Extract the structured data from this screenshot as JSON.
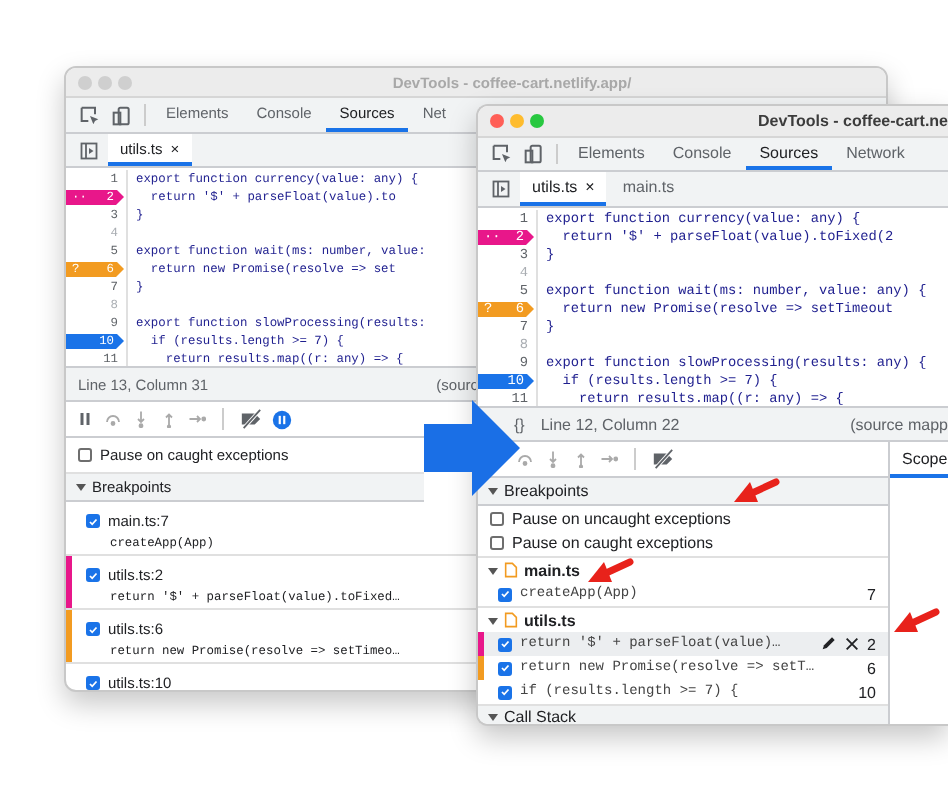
{
  "left_window": {
    "title": "DevTools - coffee-cart.netlify.app/",
    "active": false,
    "tabs": [
      {
        "label": "Elements",
        "selected": false
      },
      {
        "label": "Console",
        "selected": false
      },
      {
        "label": "Sources",
        "selected": true
      },
      {
        "label": "Net",
        "selected": false
      }
    ],
    "file_tabs": [
      {
        "label": "utils.ts",
        "close": "×",
        "selected": true
      }
    ],
    "code_lines": [
      {
        "number": "1",
        "kind": "plain",
        "text": "export function currency(value: any) {"
      },
      {
        "number": "2",
        "kind": "logpoint",
        "badge": "··",
        "text": "  return '$' + parseFloat(value).to"
      },
      {
        "number": "3",
        "kind": "plain",
        "text": "}"
      },
      {
        "number": "4",
        "kind": "plain",
        "faded": true
      },
      {
        "number": "5",
        "kind": "plain",
        "text": "export function wait(ms: number, value:"
      },
      {
        "number": "6",
        "kind": "conditional",
        "badge": "?",
        "text": "  return new Promise(resolve => set"
      },
      {
        "number": "7",
        "kind": "plain",
        "text": "}"
      },
      {
        "number": "8",
        "kind": "plain",
        "faded": true
      },
      {
        "number": "9",
        "kind": "plain",
        "text": "export function slowProcessing(results:"
      },
      {
        "number": "10",
        "kind": "regular",
        "text": "  if (results.length >= 7) {"
      },
      {
        "number": "11",
        "kind": "plain",
        "text": "    return results.map((r: any) => {"
      }
    ],
    "status": {
      "position": "Line 13, Column 31",
      "source": "(sourc"
    },
    "pause_options": [
      {
        "label": "Pause on caught exceptions",
        "checked": false
      }
    ],
    "breakpoints_header": {
      "label": "Breakpoints",
      "expanded": true
    },
    "breakpoints": [
      {
        "location": "main.ts:7",
        "code": "createApp(App)",
        "checked": true
      },
      {
        "location": "utils.ts:2",
        "code": "return '$' + parseFloat(value).toFixed…",
        "checked": true,
        "color": "#e8178a"
      },
      {
        "location": "utils.ts:6",
        "code": "return new Promise(resolve => setTimeo…",
        "checked": true,
        "color": "#f29b21"
      },
      {
        "location": "utils.ts:10",
        "checked": true
      }
    ]
  },
  "right_window": {
    "title": "DevTools - coffee-cart.ne",
    "active": true,
    "tabs": [
      {
        "label": "Elements",
        "selected": false
      },
      {
        "label": "Console",
        "selected": false
      },
      {
        "label": "Sources",
        "selected": true
      },
      {
        "label": "Network",
        "selected": false
      }
    ],
    "file_tabs": [
      {
        "label": "utils.ts",
        "close": "×",
        "selected": true
      },
      {
        "label": "main.ts",
        "selected": false
      }
    ],
    "code_lines": [
      {
        "number": "1",
        "kind": "plain",
        "text": "export function currency(value: any) {"
      },
      {
        "number": "2",
        "kind": "logpoint",
        "badge": "··",
        "text": "  return '$' + parseFloat(value).toFixed(2"
      },
      {
        "number": "3",
        "kind": "plain",
        "text": "}"
      },
      {
        "number": "4",
        "kind": "plain",
        "faded": true
      },
      {
        "number": "5",
        "kind": "plain",
        "text": "export function wait(ms: number, value: any) {"
      },
      {
        "number": "6",
        "kind": "conditional",
        "badge": "?",
        "text": "  return new Promise(resolve => setTimeout"
      },
      {
        "number": "7",
        "kind": "plain",
        "text": "}"
      },
      {
        "number": "8",
        "kind": "plain",
        "faded": true
      },
      {
        "number": "9",
        "kind": "plain",
        "text": "export function slowProcessing(results: any) {"
      },
      {
        "number": "10",
        "kind": "regular",
        "text": "  if (results.length >= 7) {"
      },
      {
        "number": "11",
        "kind": "plain",
        "text": "    return results.map((r: any) => {"
      }
    ],
    "status": {
      "format_button": "{}",
      "position": "Line 12, Column 22",
      "source": "(source mapp"
    },
    "side_tabs": [
      {
        "label": "Scope",
        "selected": true
      }
    ],
    "breakpoints_header": {
      "label": "Breakpoints",
      "expanded": true
    },
    "pause_options": [
      {
        "label": "Pause on uncaught exceptions",
        "checked": false
      },
      {
        "label": "Pause on caught exceptions",
        "checked": false
      }
    ],
    "breakpoint_groups": [
      {
        "file": "main.ts",
        "expanded": true,
        "items": [
          {
            "code": "createApp(App)",
            "line": "7",
            "checked": true,
            "hovered": false
          }
        ]
      },
      {
        "file": "utils.ts",
        "expanded": true,
        "items": [
          {
            "code": "return '$' + parseFloat(value)…",
            "line": "2",
            "checked": true,
            "color": "#e8178a",
            "hovered": true
          },
          {
            "code": "return new Promise(resolve => setT…",
            "line": "6",
            "checked": true,
            "color": "#f29b21",
            "hovered": false
          },
          {
            "code": "if (results.length >= 7) {",
            "line": "10",
            "checked": true,
            "hovered": false
          }
        ]
      }
    ],
    "call_stack_header": {
      "label": "Call Stack",
      "expanded": true
    }
  }
}
